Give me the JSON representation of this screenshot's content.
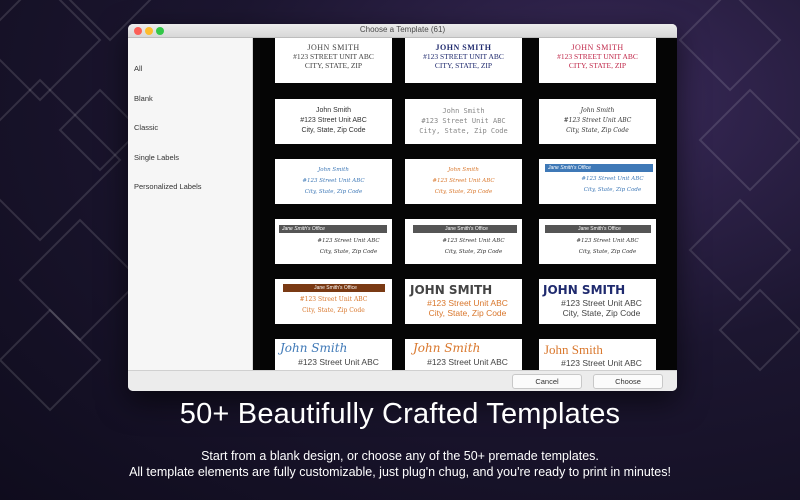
{
  "window": {
    "title": "Choose a Template (61)"
  },
  "sidebar": {
    "items": [
      {
        "label": "All"
      },
      {
        "label": "Blank"
      },
      {
        "label": "Classic"
      },
      {
        "label": "Single Labels"
      },
      {
        "label": "Personalized Labels"
      }
    ]
  },
  "templates": {
    "name_caps": "JOHN SMITH",
    "street_caps": "#123 STREET UNIT ABC",
    "city_caps": "CITY, STATE, ZIP",
    "name": "John Smith",
    "street": "#123 Street Unit ABC",
    "city": "City, State, Zip Code",
    "office": "Jane Smith's Office",
    "accent_colors": {
      "dark": "#444444",
      "navy": "#1f2a6e",
      "crimson": "#c0284a",
      "blue": "#3f79b7",
      "orange": "#d9772c",
      "brown": "#7a3a14",
      "gray_bar": "#555555"
    }
  },
  "buttons": {
    "cancel": "Cancel",
    "choose": "Choose"
  },
  "promo": {
    "headline": "50+ Beautifully Crafted Templates",
    "line1": "Start from a blank design, or choose any of the 50+ premade templates.",
    "line2": "All template elements are fully customizable, just plug'n chug, and you're ready to print in minutes!"
  }
}
